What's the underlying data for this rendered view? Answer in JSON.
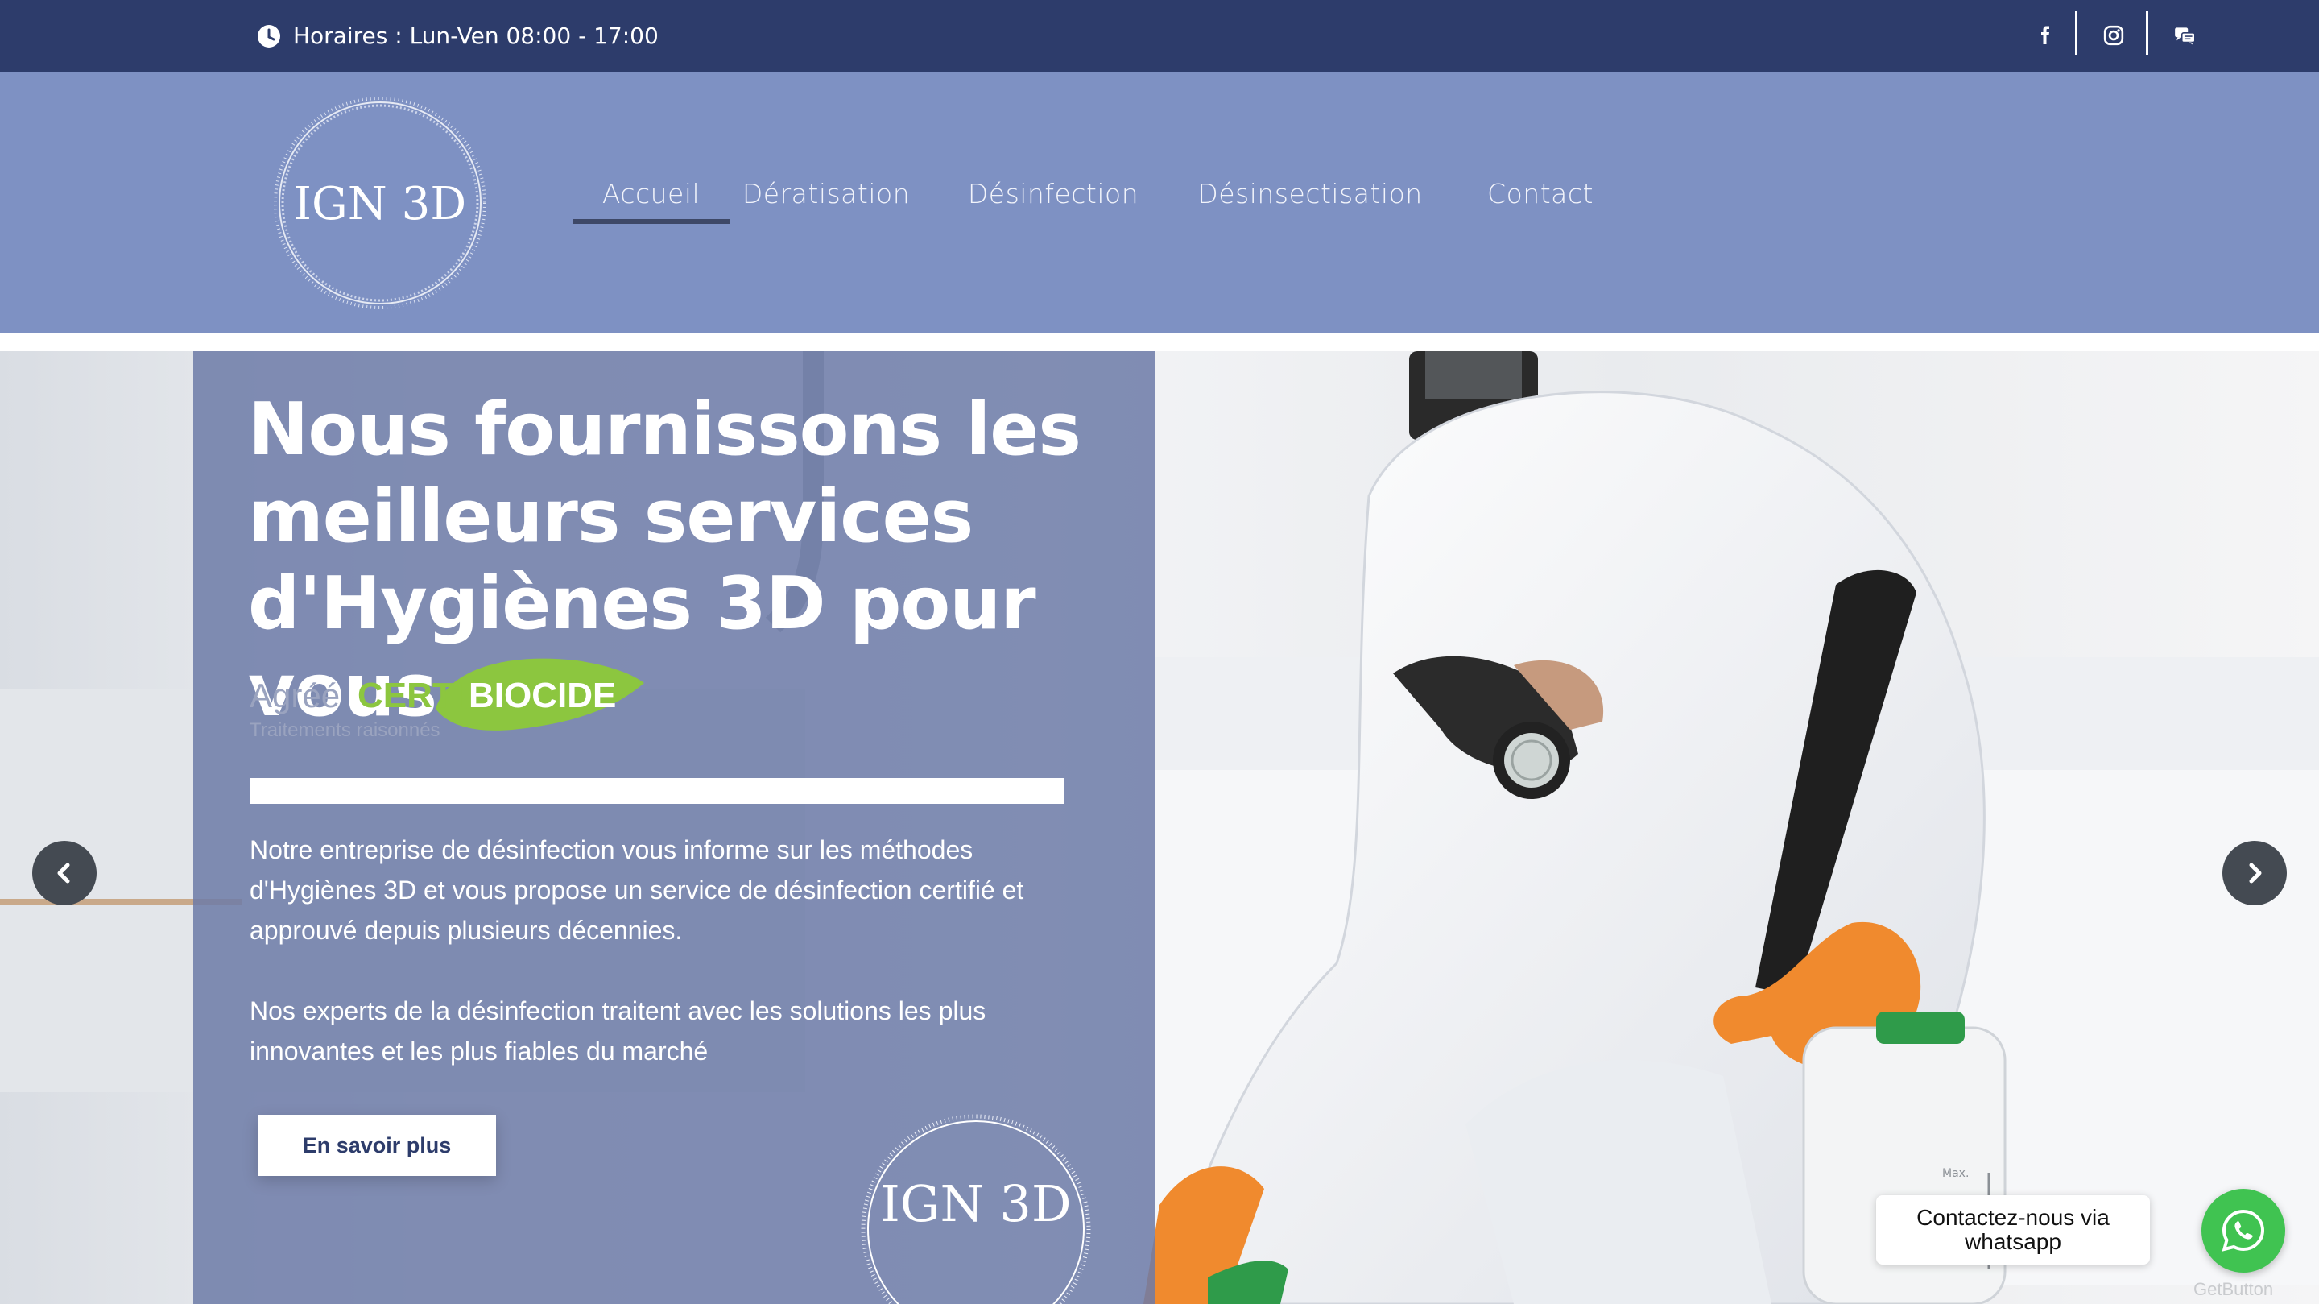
{
  "topbar": {
    "hours_text": "Horaires : Lun-Ven 08:00 - 17:00",
    "icons": [
      "clock-icon",
      "facebook-icon",
      "instagram-icon",
      "chat-icon"
    ]
  },
  "header": {
    "logo_text": "IGN 3D",
    "nav": [
      {
        "label": "Accueil",
        "active": true
      },
      {
        "label": "Dératisation",
        "active": false
      },
      {
        "label": "Désinfection",
        "active": false
      },
      {
        "label": "Désinsectisation",
        "active": false
      },
      {
        "label": "Contact",
        "active": false
      }
    ]
  },
  "hero": {
    "headline": [
      "Nous fournissons les",
      "meilleurs services",
      "d'Hygiènes 3D pour vous"
    ],
    "certi": {
      "agree": "Agréé",
      "certi": "CERTI",
      "biocide": "BIOCIDE",
      "tagline": "Traitements raisonnés"
    },
    "paragraph1": "Notre entreprise de désinfection vous informe sur les méthodes d'Hygiènes 3D et vous propose un service de désinfection certifié et approuvé depuis plusieurs décennies.",
    "paragraph2": "Nos experts de la désinfection traitent avec les solutions les plus innovantes et les plus fiables du marché",
    "cta_label": "En savoir plus",
    "panel_logo_text": "IGN 3D"
  },
  "whatsapp": {
    "bubble_line1": "Contactez-nous via",
    "bubble_line2": "whatsapp",
    "brand": "GetButton"
  },
  "colors": {
    "topbar": "#2d3c6b",
    "header": "#7e91c3",
    "panel": "#6e7ba8",
    "whatsapp": "#40c351"
  }
}
